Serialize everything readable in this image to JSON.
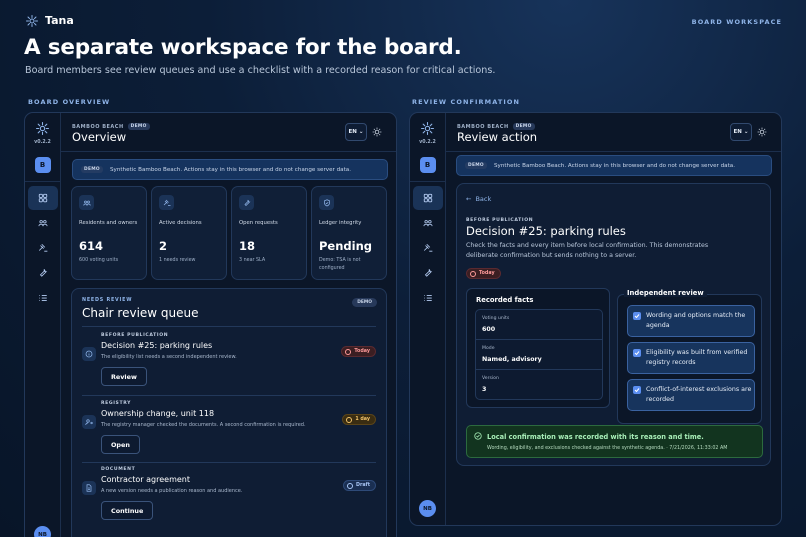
{
  "brand": {
    "name": "Tana",
    "workspace_label": "BOARD WORKSPACE"
  },
  "hero": {
    "title": "A separate workspace for the board.",
    "subtitle": "Board members see review queues and use a checklist with a recorded reason for critical actions."
  },
  "sections": {
    "left": "BOARD OVERVIEW",
    "right": "REVIEW CONFIRMATION"
  },
  "rail": {
    "version": "v0.2.2",
    "workspace_initial": "B",
    "avatar": "NB",
    "nav_icons": [
      "grid-icon",
      "users-icon",
      "gavel-icon",
      "wrench-icon",
      "checklist-icon"
    ]
  },
  "overview": {
    "crumb": "BAMBOO BEACH",
    "crumb_chip": "DEMO",
    "title": "Overview",
    "lang": "EN",
    "banner_chip": "DEMO",
    "banner_text": "Synthetic Bamboo Beach. Actions stay in this browser and do not change server data.",
    "stats": [
      {
        "label": "Residents and owners",
        "value": "614",
        "sub": "600 voting units",
        "icon": "users-icon"
      },
      {
        "label": "Active decisions",
        "value": "2",
        "sub": "1 needs review",
        "icon": "gavel-icon"
      },
      {
        "label": "Open requests",
        "value": "18",
        "sub": "3 near SLA",
        "icon": "wrench-icon"
      },
      {
        "label": "Ledger integrity",
        "value": "Pending",
        "sub": "Demo: TSA is not configured",
        "icon": "shield-icon"
      }
    ],
    "queue": {
      "kicker": "NEEDS REVIEW",
      "title": "Chair review queue",
      "chip": "DEMO",
      "items": [
        {
          "kicker": "BEFORE PUBLICATION",
          "title": "Decision #25: parking rules",
          "desc": "The eligibility list needs a second independent review.",
          "button": "Review",
          "badge": "Today",
          "badge_color": "red",
          "icon": "info-icon"
        },
        {
          "kicker": "REGISTRY",
          "title": "Ownership change, unit 118",
          "desc": "The registry manager checked the documents. A second confirmation is required.",
          "button": "Open",
          "badge": "1 day",
          "badge_color": "amber",
          "icon": "user-switch-icon"
        },
        {
          "kicker": "DOCUMENT",
          "title": "Contractor agreement",
          "desc": "A new version needs a publication reason and audience.",
          "button": "Continue",
          "badge": "Draft",
          "badge_color": "blue",
          "icon": "document-icon"
        }
      ]
    }
  },
  "review": {
    "crumb": "BAMBOO BEACH",
    "crumb_chip": "DEMO",
    "title": "Review action",
    "lang": "EN",
    "banner_chip": "DEMO",
    "banner_text": "Synthetic Bamboo Beach. Actions stay in this browser and do not change server data.",
    "back": "Back",
    "kicker": "BEFORE PUBLICATION",
    "decision_title": "Decision #25: parking rules",
    "description": "Check the facts and every item before local confirmation. This demonstrates deliberate confirmation but sends nothing to a server.",
    "badge": "Today",
    "facts": {
      "heading": "Recorded facts",
      "rows": [
        {
          "key": "Voting units",
          "value": "600"
        },
        {
          "key": "Mode",
          "value": "Named, advisory"
        },
        {
          "key": "Version",
          "value": "3"
        }
      ]
    },
    "independent": {
      "heading": "Independent review",
      "checks": [
        {
          "text": "Wording and options match the agenda",
          "checked": true
        },
        {
          "text": "Eligibility was built from verified registry records",
          "checked": true
        },
        {
          "text": "Conflict-of-interest exclusions are recorded",
          "checked": true
        }
      ]
    },
    "success": {
      "title": "Local confirmation was recorded with its reason and time.",
      "detail": "Wording, eligibility, and exclusions checked against the synthetic agenda. · 7/21/2026, 11:33:02 AM"
    }
  },
  "colors": {
    "accent": "#5b8ef0",
    "background": "#0c1e38",
    "success": "#12341f",
    "danger": "#ff9b9b",
    "warning": "#f3c46a"
  }
}
